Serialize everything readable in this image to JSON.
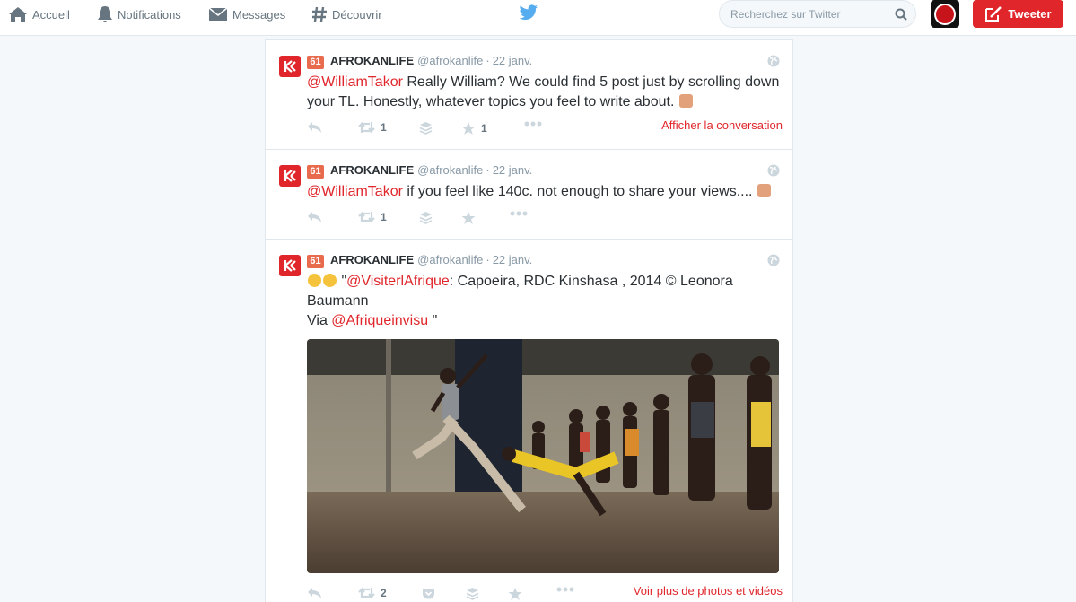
{
  "nav": {
    "home_label": "Accueil",
    "notifications_label": "Notifications",
    "messages_label": "Messages",
    "discover_label": "Découvrir"
  },
  "search": {
    "placeholder": "Recherchez sur Twitter"
  },
  "compose": {
    "label": "Tweeter"
  },
  "accent_color": "#e0262b",
  "tweets": [
    {
      "badge": "61",
      "fullname": "AFROKANLIFE",
      "username": "@afrokanlife",
      "time": "22 janv.",
      "mention": "@WilliamTakor",
      "text": " Really William? We could find 5 post just by scrolling down your TL. Honestly, whatever topics you feel to write about.",
      "emoji": "thumbs-up",
      "retweets": "1",
      "favorites": "1",
      "link": "Afficher la conversation"
    },
    {
      "badge": "61",
      "fullname": "AFROKANLIFE",
      "username": "@afrokanlife",
      "time": "22 janv.",
      "mention": "@WilliamTakor",
      "text": " if you feel like 140c. not enough to share your views....",
      "emoji": "victory-hand",
      "retweets": "1"
    },
    {
      "badge": "61",
      "fullname": "AFROKANLIFE",
      "username": "@afrokanlife",
      "time": "22 janv.",
      "open_quote": " \"",
      "mention": "@VisiterlAfrique",
      "text": ": Capoeira, RDC Kinshasa , 2014 © Leonora Baumann",
      "via_label": "Via ",
      "mention2": "@Afriqueinvisu",
      "close_quote": " \"",
      "emoji": "heart-eyes",
      "retweets": "2",
      "link": "Voir plus de photos et vidéos"
    }
  ]
}
